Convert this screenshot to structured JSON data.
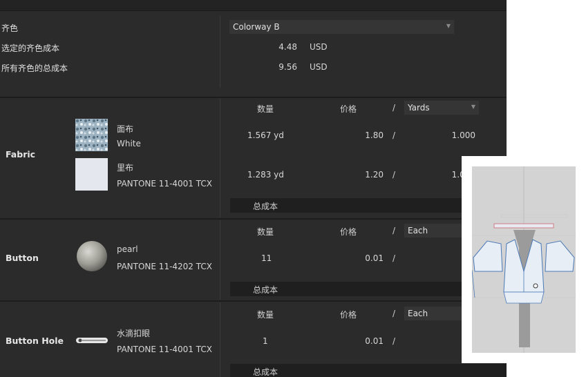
{
  "summary": {
    "colorway_label": "齐色",
    "colorway_value": "Colorway B",
    "selected_cost_label": "选定的齐色成本",
    "selected_cost_value": "4.48",
    "selected_cost_currency": "USD",
    "total_cost_label": "所有齐色的总成本",
    "total_cost_value": "9.56",
    "total_cost_currency": "USD"
  },
  "headers": {
    "quantity": "数量",
    "price": "价格",
    "slash": "/"
  },
  "total_label": "总成本",
  "sections": [
    {
      "label": "Fabric",
      "unit_select": "Yards",
      "items": [
        {
          "name": "面布",
          "sub": "White",
          "quantity": "1.567 yd",
          "price": "1.80",
          "per": "1.000"
        },
        {
          "name": "里布",
          "sub": "PANTONE 11-4001 TCX",
          "quantity": "1.283 yd",
          "price": "1.20",
          "per": "1.000"
        }
      ]
    },
    {
      "label": "Button",
      "unit_select": "Each",
      "items": [
        {
          "name": "pearl",
          "sub": "PANTONE 11-4202 TCX",
          "quantity": "11",
          "price": "0.01"
        }
      ]
    },
    {
      "label": "Button Hole",
      "unit_select": "Each",
      "items": [
        {
          "name": "水滴扣眼",
          "sub": "PANTONE 11-4001 TCX",
          "quantity": "1",
          "price": "0.01"
        }
      ]
    }
  ],
  "icons": {
    "dropdown": "chevron-down-icon",
    "fabric_swatch": "fabric-print-swatch",
    "lining_swatch": "lining-swatch",
    "button": "pearl-button-icon",
    "buttonhole": "buttonhole-icon"
  }
}
